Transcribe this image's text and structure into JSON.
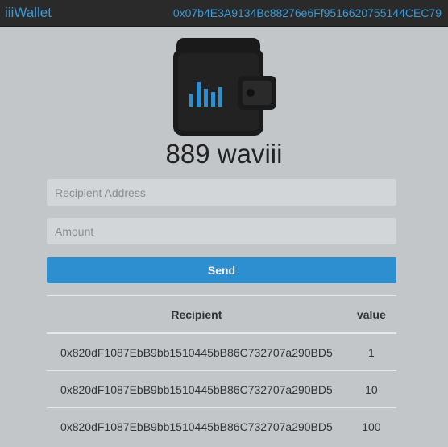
{
  "header": {
    "brand": "iiiWallet",
    "address": "0x07b4E3A9134Bc88276e6Ff9516620755144CEC79"
  },
  "wallet": {
    "icon": "wallet-icon",
    "balance": "889 waviii"
  },
  "form": {
    "recipient_placeholder": "Recipient Address",
    "amount_placeholder": "Amount",
    "send_label": "Send"
  },
  "transactions": {
    "headers": {
      "recipient": "Recipient",
      "value": "value"
    },
    "rows": [
      {
        "recipient": "0x820dF1087EbB9bb1510445bB86C732707a290BD5",
        "value": "1"
      },
      {
        "recipient": "0x820dF1087EbB9bb1510445bB86C732707a290BD5",
        "value": "10"
      },
      {
        "recipient": "0x820dF1087EbB9bb1510445bB86C732707a290BD5",
        "value": "100"
      }
    ]
  },
  "colors": {
    "accent": "#2e8fd0",
    "link": "#3a9ad6",
    "background": "#c3c6c9",
    "topbar": "#2a2a2a"
  }
}
